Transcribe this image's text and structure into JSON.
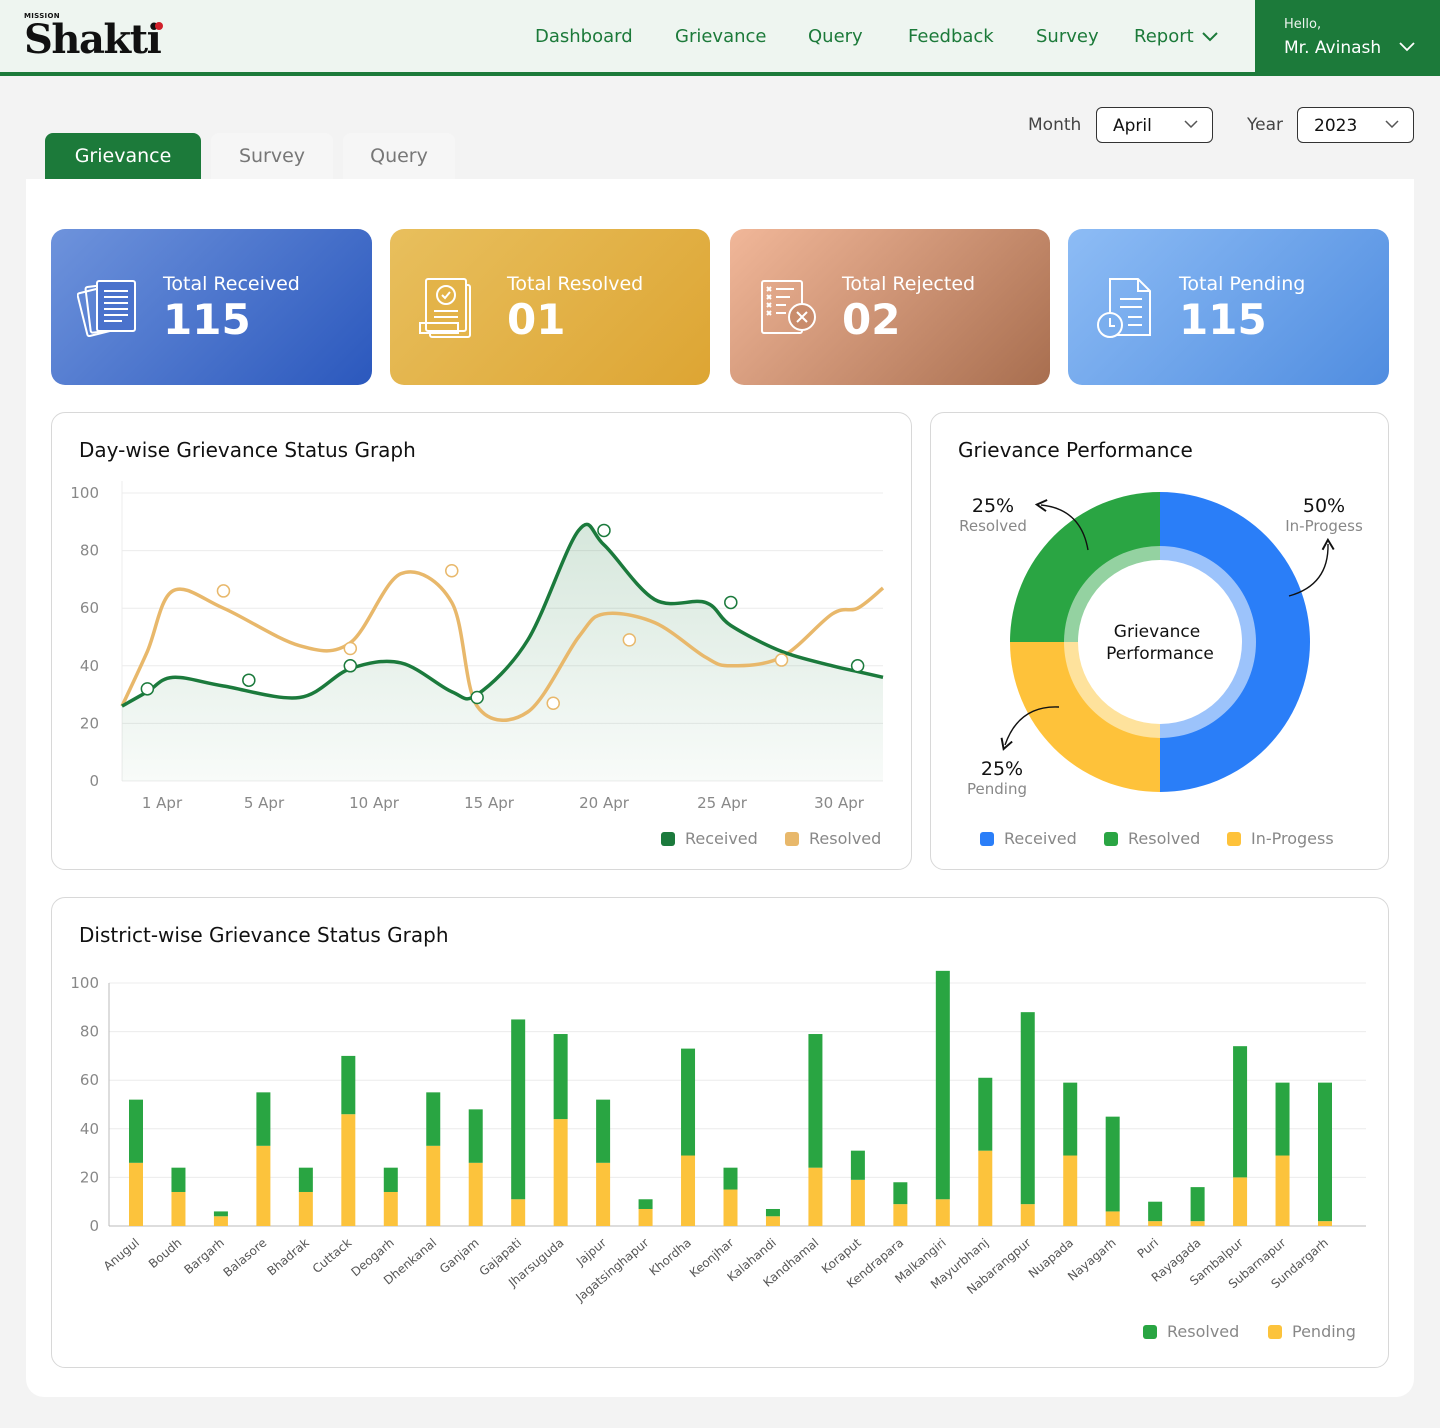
{
  "header": {
    "logo_top": "MISSION",
    "logo_name": "Shakti",
    "nav": [
      "Dashboard",
      "Grievance",
      "Query",
      "Feedback",
      "Survey",
      "Report"
    ],
    "user_hello": "Hello,",
    "user_name": "Mr. Avinash"
  },
  "filters": {
    "month_label": "Month",
    "month_value": "April",
    "year_label": "Year",
    "year_value": "2023"
  },
  "tabs": [
    "Grievance",
    "Survey",
    "Query"
  ],
  "cards": [
    {
      "label": "Total Received",
      "value": "115",
      "icon": "documents-stack-icon"
    },
    {
      "label": "Total Resolved",
      "value": "01",
      "icon": "approved-document-icon"
    },
    {
      "label": "Total Rejected",
      "value": "02",
      "icon": "rejected-document-icon"
    },
    {
      "label": "Total Pending",
      "value": "115",
      "icon": "pending-document-clock-icon"
    }
  ],
  "colors": {
    "brand_green": "#1c7a3a",
    "received_green": "#1b7a3c",
    "resolved_orange": "#e8b86b",
    "donut_blue": "#2a7ef8",
    "donut_green": "#2aa543",
    "donut_yellow": "#fec23a",
    "bar_green": "#29a542",
    "bar_yellow": "#fcc33c"
  },
  "day_chart": {
    "title": "Day-wise Grievance Status Graph",
    "y_ticks": [
      "100",
      "80",
      "60",
      "40",
      "20",
      "0"
    ],
    "x_ticks": [
      "1 Apr",
      "5 Apr",
      "10 Apr",
      "15 Apr",
      "20 Apr",
      "25 Apr",
      "30 Apr"
    ],
    "legend": [
      "Received",
      "Resolved"
    ]
  },
  "donut": {
    "title": "Grievance Performance",
    "center_line1": "Grievance",
    "center_line2": "Performance",
    "resolved_pct": "25%",
    "resolved_label": "Resolved",
    "inprog_pct": "50%",
    "inprog_label": "In-Progess",
    "pending_pct": "25%",
    "pending_label": "Pending",
    "legend": [
      "Received",
      "Resolved",
      "In-Progess"
    ]
  },
  "district_chart": {
    "title": "District-wise Grievance Status Graph",
    "y_ticks": [
      "100",
      "80",
      "60",
      "40",
      "20",
      "0"
    ],
    "legend": [
      "Resolved",
      "Pending"
    ]
  },
  "chart_data": [
    {
      "type": "line",
      "title": "Day-wise Grievance Status Graph",
      "x": [
        1,
        2,
        3,
        5,
        8,
        10,
        12,
        14,
        15,
        17,
        19,
        20,
        22,
        24,
        25,
        27,
        29,
        30,
        31
      ],
      "x_tick_labels": [
        "1 Apr",
        "5 Apr",
        "10 Apr",
        "15 Apr",
        "20 Apr",
        "25 Apr",
        "30 Apr"
      ],
      "ylim": [
        0,
        100
      ],
      "series": [
        {
          "name": "Received",
          "values": [
            26,
            31,
            36,
            33,
            29,
            39,
            41,
            31,
            30,
            49,
            87,
            82,
            63,
            62,
            54,
            45,
            40,
            38,
            36
          ]
        },
        {
          "name": "Resolved",
          "values": [
            26,
            45,
            66,
            60,
            47,
            48,
            72,
            62,
            26,
            24,
            50,
            58,
            55,
            43,
            40,
            43,
            58,
            60,
            67
          ]
        }
      ],
      "markers": {
        "Received": [
          [
            2,
            32
          ],
          [
            6,
            35
          ],
          [
            10,
            40
          ],
          [
            15,
            29
          ],
          [
            20,
            87
          ],
          [
            25,
            62
          ],
          [
            30,
            40
          ]
        ],
        "Resolved": [
          [
            5,
            66
          ],
          [
            10,
            46
          ],
          [
            14,
            73
          ],
          [
            18,
            27
          ],
          [
            21,
            49
          ],
          [
            27,
            42
          ]
        ]
      },
      "legend": [
        "Received",
        "Resolved"
      ]
    },
    {
      "type": "pie",
      "title": "Grievance Performance",
      "labels": [
        "In-Progess",
        "Pending",
        "Resolved"
      ],
      "values": [
        50,
        25,
        25
      ],
      "legend": [
        "Received",
        "Resolved",
        "In-Progess"
      ]
    },
    {
      "type": "bar",
      "title": "District-wise Grievance Status Graph",
      "stacked": true,
      "ylim": [
        0,
        100
      ],
      "categories": [
        "Anugul",
        "Boudh",
        "Bargarh",
        "Balasore",
        "Bhadrak",
        "Cuttack",
        "Deogarh",
        "Dhenkanal",
        "Ganjam",
        "Gajapati",
        "Jharsuguda",
        "Jajpur",
        "Jagatsinghapur",
        "Khordha",
        "Keonjhar",
        "Kalahandi",
        "Kandhamal",
        "Koraput",
        "Kendrapara",
        "Malkangiri",
        "Mayurbhanj",
        "Nabarangpur",
        "Nuapada",
        "Nayagarh",
        "Puri",
        "Rayagada",
        "Sambalpur",
        "Subarnapur",
        "Sundargarh"
      ],
      "series": [
        {
          "name": "Pending",
          "values": [
            26,
            14,
            4,
            33,
            14,
            46,
            14,
            33,
            26,
            11,
            44,
            26,
            7,
            29,
            15,
            4,
            24,
            19,
            9,
            11,
            31,
            9,
            29,
            6,
            2,
            2,
            20,
            29,
            2
          ]
        },
        {
          "name": "Resolved",
          "values": [
            26,
            10,
            2,
            22,
            10,
            24,
            10,
            22,
            22,
            74,
            35,
            26,
            4,
            44,
            9,
            3,
            55,
            12,
            9,
            94,
            30,
            79,
            30,
            39,
            8,
            14,
            54,
            30,
            57
          ]
        }
      ],
      "legend": [
        "Resolved",
        "Pending"
      ]
    }
  ]
}
